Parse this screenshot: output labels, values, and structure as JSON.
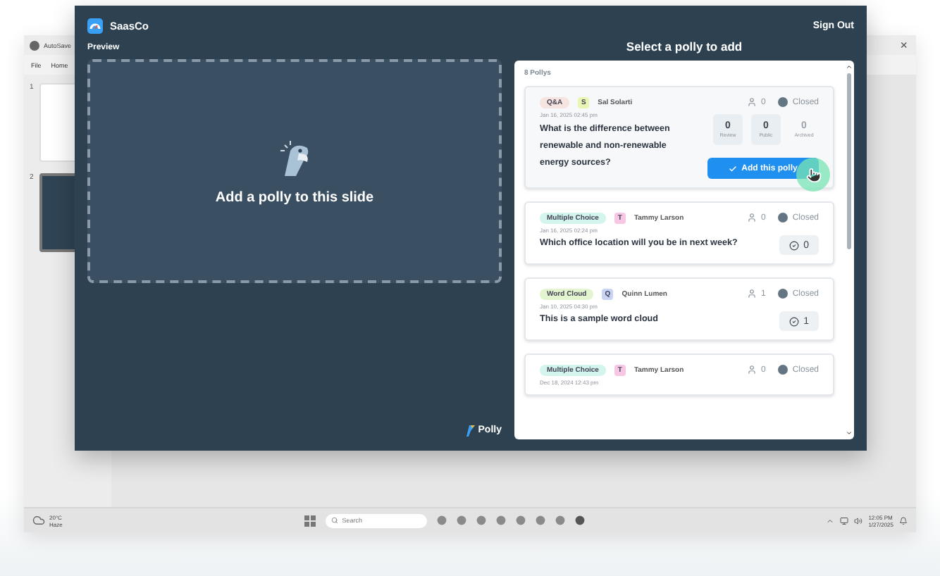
{
  "desktop_app": {
    "title": "AutoSave",
    "menu": [
      "File",
      "Home"
    ],
    "close": "×",
    "slides": [
      {
        "number": "1",
        "selected": false
      },
      {
        "number": "2",
        "selected": true
      }
    ]
  },
  "taskbar": {
    "temperature": "20°C",
    "weather": "Haze",
    "search_placeholder": "Search",
    "time": "12:05 PM",
    "date": "1/27/2025"
  },
  "modal": {
    "brand": "SaasCo",
    "sign_out": "Sign Out",
    "preview_label": "Preview",
    "empty_text": "Add a polly to this slide",
    "footer_logo": "Polly",
    "list_title": "Select a polly to add",
    "count": "8 Pollys",
    "polls": [
      {
        "kind": "expanded",
        "type": {
          "label": "Q&A",
          "color": "#f6e4e1"
        },
        "author": {
          "initial": "S",
          "name": "Sal Solarti",
          "color": "#e8f5b5"
        },
        "participants": "0",
        "status": "Closed",
        "date": "Jan 16, 2025 02:45 pm",
        "question": "What is the difference between renewable and non-renewable energy sources?",
        "stats": [
          {
            "value": "0",
            "label": "Review",
            "boxed": true
          },
          {
            "value": "0",
            "label": "Public",
            "boxed": true
          },
          {
            "value": "0",
            "label": "Archived",
            "boxed": false
          }
        ],
        "action": "Add this polly"
      },
      {
        "kind": "compact",
        "type": {
          "label": "Multiple Choice",
          "color": "#d4f5ee"
        },
        "author": {
          "initial": "T",
          "name": "Tammy Larson",
          "color": "#f7c6e3"
        },
        "participants": "0",
        "status": "Closed",
        "date": "Jan 16, 2025 02:24 pm",
        "question": "Which office location will you be in next week?",
        "responses": "0"
      },
      {
        "kind": "compact",
        "type": {
          "label": "Word Cloud",
          "color": "#e3f5cf"
        },
        "author": {
          "initial": "Q",
          "name": "Quinn Lumen",
          "color": "#c9d4f5"
        },
        "participants": "1",
        "status": "Closed",
        "date": "Jan 10, 2025 04:30 pm",
        "question": "This is a sample word cloud",
        "responses": "1"
      },
      {
        "kind": "compact",
        "type": {
          "label": "Multiple Choice",
          "color": "#d4f5ee"
        },
        "author": {
          "initial": "T",
          "name": "Tammy Larson",
          "color": "#f7c6e3"
        },
        "participants": "0",
        "status": "Closed",
        "date": "Dec 18, 2024 12:43 pm"
      }
    ]
  }
}
